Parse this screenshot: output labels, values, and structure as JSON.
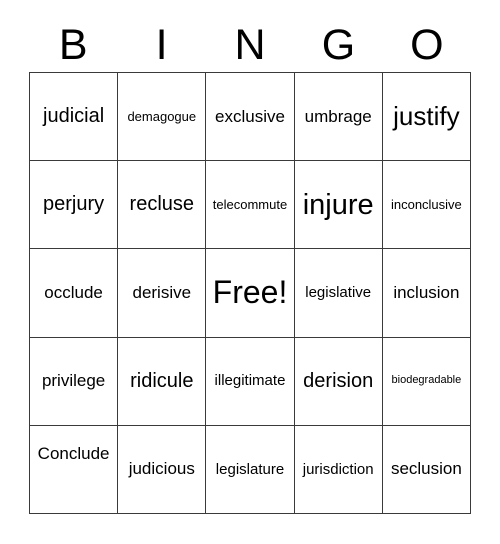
{
  "card": {
    "title": "BINGO",
    "header_letters": [
      "B",
      "I",
      "N",
      "G",
      "O"
    ],
    "free_space_label": "Free!",
    "grid_size": "5x5",
    "colors": {
      "background": "#ffffff",
      "text": "#000000",
      "border": "#3a3a3a"
    },
    "rows": [
      [
        {
          "text": "judicial",
          "size": "fs-l",
          "free": false
        },
        {
          "text": "demagogue",
          "size": "fs-xs",
          "free": false
        },
        {
          "text": "exclusive",
          "size": "fs-m",
          "free": false
        },
        {
          "text": "umbrage",
          "size": "fs-m",
          "free": false
        },
        {
          "text": "justify",
          "size": "fs-xl",
          "free": false
        }
      ],
      [
        {
          "text": "perjury",
          "size": "fs-l",
          "free": false
        },
        {
          "text": "recluse",
          "size": "fs-l",
          "free": false
        },
        {
          "text": "telecommute",
          "size": "fs-xs",
          "free": false
        },
        {
          "text": "injure",
          "size": "fs-xxl",
          "free": false
        },
        {
          "text": "inconclusive",
          "size": "fs-xs",
          "free": false
        }
      ],
      [
        {
          "text": "occlude",
          "size": "fs-m",
          "free": false
        },
        {
          "text": "derisive",
          "size": "fs-m",
          "free": false
        },
        {
          "text": "Free!",
          "size": "fs-free",
          "free": true
        },
        {
          "text": "legislative",
          "size": "fs-s",
          "free": false
        },
        {
          "text": "inclusion",
          "size": "fs-m",
          "free": false
        }
      ],
      [
        {
          "text": "privilege",
          "size": "fs-m",
          "free": false
        },
        {
          "text": "ridicule",
          "size": "fs-l",
          "free": false
        },
        {
          "text": "illegitimate",
          "size": "fs-s",
          "free": false
        },
        {
          "text": "derision",
          "size": "fs-l",
          "free": false
        },
        {
          "text": "biodegradable",
          "size": "fs-xxs",
          "free": false
        }
      ],
      [
        {
          "text": "Conclude",
          "size": "fs-m",
          "free": false
        },
        {
          "text": "judicious",
          "size": "fs-m",
          "free": false
        },
        {
          "text": "legislature",
          "size": "fs-s",
          "free": false
        },
        {
          "text": "jurisdiction",
          "size": "fs-s",
          "free": false
        },
        {
          "text": "seclusion",
          "size": "fs-m",
          "free": false
        }
      ]
    ]
  }
}
